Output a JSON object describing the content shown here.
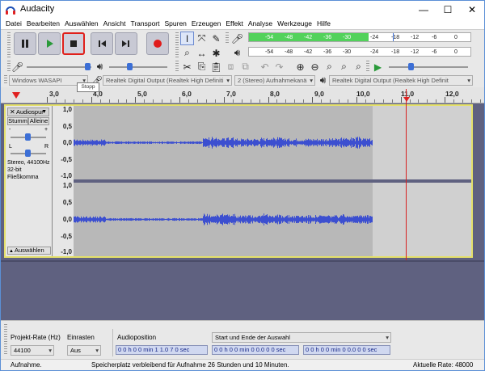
{
  "window": {
    "title": "Audacity",
    "controls": {
      "minimize": "—",
      "maximize": "☐",
      "close": "✕"
    }
  },
  "menu": [
    "Datei",
    "Bearbeiten",
    "Auswählen",
    "Ansicht",
    "Transport",
    "Spuren",
    "Erzeugen",
    "Effekt",
    "Analyse",
    "Werkzeuge",
    "Hilfe"
  ],
  "transport": {
    "tooltip": "Stopp"
  },
  "meters": {
    "record_labels": [
      "-54",
      "-48",
      "-42",
      "-36",
      "-30",
      "-24",
      "-18",
      "-12",
      "-6",
      "0"
    ],
    "playback_labels": [
      "-54",
      "-48",
      "-42",
      "-36",
      "-30",
      "-24",
      "-18",
      "-12",
      "-6",
      "0"
    ],
    "click_to_monitor": ""
  },
  "devices": {
    "host": "Windows WASAPI",
    "recording_device": "Realtek Digital Output (Realtek High Definiti",
    "channels": "2 (Stereo) Aufnahmekanä",
    "playback_device": "Realtek Digital Output (Realtek High Definit"
  },
  "ruler": {
    "labels": [
      "3,0",
      "4,0",
      "5,0",
      "6,0",
      "7,0",
      "8,0",
      "9,0",
      "10,0",
      "11,0",
      "12,0"
    ]
  },
  "track": {
    "name": "Audiospur",
    "mute": "Stumm",
    "solo": "Alleine",
    "gain_minus": "-",
    "gain_plus": "+",
    "pan_left": "L",
    "pan_right": "R",
    "info_line1": "Stereo, 44100Hz",
    "info_line2": "32-bit Fließkomma",
    "select_button": "Auswählen",
    "scale_ch1": [
      "1,0",
      "0,5",
      "0,0",
      "-0,5",
      "-1,0"
    ],
    "scale_ch2": [
      "1,0",
      "0,5",
      "0,0",
      "-0,5",
      "-1,0"
    ]
  },
  "selection_toolbar": {
    "rate_label": "Projekt-Rate (Hz)",
    "rate_value": "44100",
    "snap_label": "Einrasten",
    "snap_value": "Aus",
    "position_label": "Audioposition",
    "position_value": "0 0 h 0 0 min 1 1.0 7 0 sec",
    "selection_label": "Start und Ende der Auswahl",
    "sel_start": "0 0 h 0 0 min 0 0.0 0 0 sec",
    "sel_end": "0 0 h 0 0 min 0 0.0 0 0 sec"
  },
  "statusbar": {
    "state": "Aufnahme.",
    "space": "Speicherplatz verbleibend für Aufnahme 26 Stunden und 10 Minuten.",
    "rate": "Aktuelle Rate: 48000"
  },
  "colors": {
    "waveform": "#3c4fd0",
    "meter_green": "#52d25b",
    "track_selected_border": "#e4e06a",
    "record_red": "#e01b1b",
    "background_gray": "#5f6180"
  }
}
